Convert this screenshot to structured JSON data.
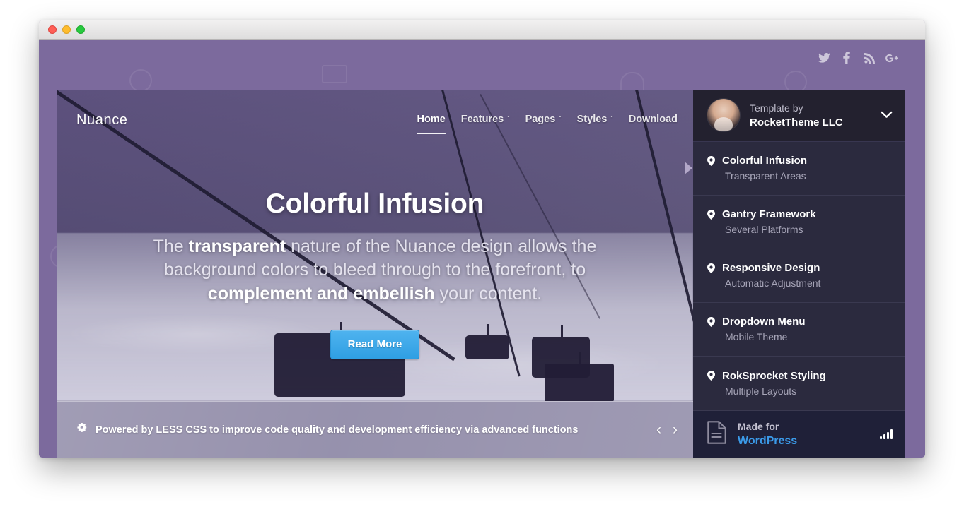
{
  "window": {
    "traffic_lights": [
      "close",
      "minimize",
      "maximize"
    ],
    "title": ""
  },
  "social": [
    {
      "name": "twitter-icon",
      "label": "Twitter"
    },
    {
      "name": "facebook-icon",
      "label": "Facebook"
    },
    {
      "name": "rss-icon",
      "label": "RSS"
    },
    {
      "name": "googleplus-icon",
      "label": "Google Plus"
    }
  ],
  "nav": {
    "logo": "Nuance",
    "items": [
      {
        "label": "Home",
        "active": true,
        "caret": false
      },
      {
        "label": "Features",
        "active": false,
        "caret": true,
        "caret_glyph": "ˇ"
      },
      {
        "label": "Pages",
        "active": false,
        "caret": true,
        "caret_glyph": "ˇ"
      },
      {
        "label": "Styles",
        "active": false,
        "caret": true,
        "caret_glyph": "ˇ"
      },
      {
        "label": "Download",
        "active": false,
        "caret": false
      }
    ]
  },
  "hero": {
    "title": "Colorful Infusion",
    "body_part1": "The ",
    "body_strong1": "transparent",
    "body_part2": " nature of the Nuance design allows the background colors to bleed through to the forefront, to ",
    "body_strong2": "complement and embellish",
    "body_part3": " your content.",
    "cta_label": "Read More"
  },
  "ticker": {
    "icon": "cogs-icon",
    "text": "Powered by LESS CSS to improve code quality and development efficiency via advanced functions",
    "prev_glyph": "‹",
    "next_glyph": "›"
  },
  "sidebar": {
    "author": {
      "label": "Template by",
      "name": "RocketTheme LLC",
      "chevron_glyph": "❯"
    },
    "items": [
      {
        "title": "Colorful Infusion",
        "subtitle": "Transparent Areas",
        "active": true
      },
      {
        "title": "Gantry Framework",
        "subtitle": "Several Platforms",
        "active": false
      },
      {
        "title": "Responsive Design",
        "subtitle": "Automatic Adjustment",
        "active": false
      },
      {
        "title": "Dropdown Menu",
        "subtitle": "Mobile Theme",
        "active": false
      },
      {
        "title": "RokSprocket Styling",
        "subtitle": "Multiple Layouts",
        "active": false
      }
    ],
    "made_for": {
      "label": "Made for",
      "name": "WordPress"
    }
  },
  "colors": {
    "page_purple": "#7c6a9d",
    "sidebar_dark": "#2b2a3e",
    "sidebar_header": "#23212f",
    "madefor_bg": "#1f2038",
    "accent_blue": "#3b9ae8",
    "cta_blue": "#2f9fe3",
    "active_marker": "#b3a8c9"
  }
}
